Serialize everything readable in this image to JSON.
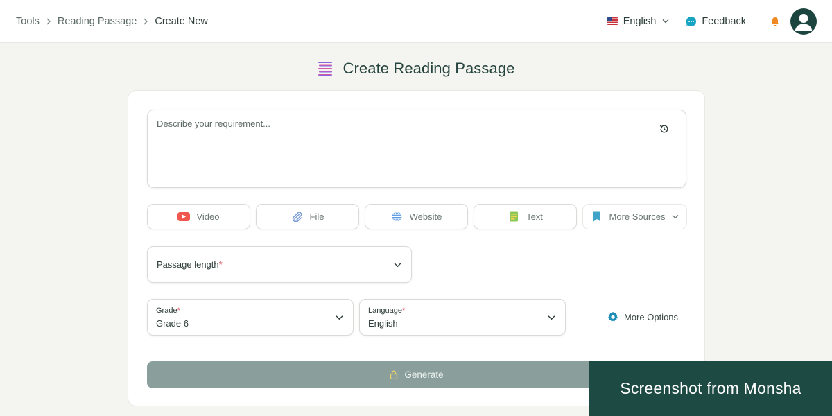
{
  "breadcrumb": {
    "items": [
      "Tools",
      "Reading Passage",
      "Create New"
    ]
  },
  "header": {
    "language_label": "English",
    "feedback_label": "Feedback"
  },
  "page": {
    "title": "Create Reading Passage"
  },
  "form": {
    "requirement_placeholder": "Describe your requirement...",
    "requirement_value": "",
    "sources": [
      {
        "label": "Video",
        "icon": "youtube-icon"
      },
      {
        "label": "File",
        "icon": "paperclip-icon"
      },
      {
        "label": "Website",
        "icon": "globe-icon"
      },
      {
        "label": "Text",
        "icon": "text-document-icon"
      },
      {
        "label": "More Sources",
        "icon": "bookmark-icon"
      }
    ],
    "passage_length_label": "Passage length",
    "required_mark": "*",
    "grade_label": "Grade",
    "grade_value": "Grade 6",
    "language_label": "Language",
    "language_value": "English",
    "more_options_label": "More Options",
    "generate_label": "Generate"
  },
  "watermark": {
    "text": "Screenshot from Monsha"
  },
  "colors": {
    "background": "#f4f5f0",
    "accent_dark": "#1d4540",
    "generate_disabled": "#8a9f9b",
    "required": "#d94452"
  }
}
